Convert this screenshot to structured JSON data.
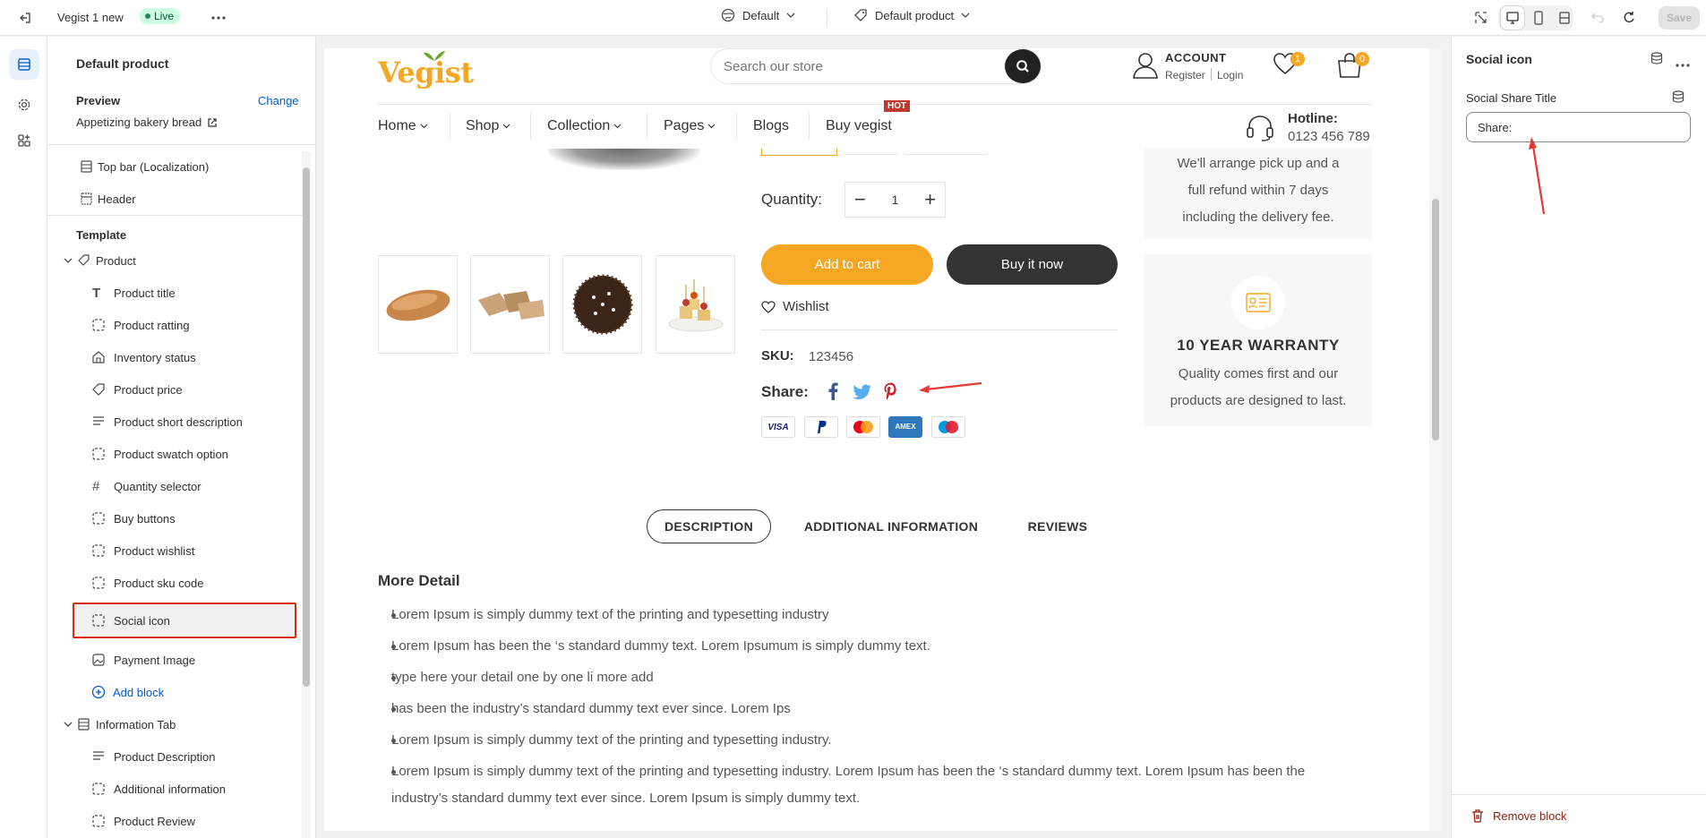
{
  "topbar": {
    "title": "Vegist 1 new",
    "status": "Live",
    "theme_select": "Default",
    "template_select": "Default product",
    "save_label": "Save"
  },
  "sidebar": {
    "heading": "Default product",
    "preview_label": "Preview",
    "preview_change": "Change",
    "preview_value": "Appetizing bakery bread",
    "top_items": [
      "Top bar (Localization)",
      "Header"
    ],
    "template_label": "Template",
    "product_section": "Product",
    "product_blocks": [
      "Product title",
      "Product ratting",
      "Inventory status",
      "Product price",
      "Product short description",
      "Product swatch option",
      "Quantity selector",
      "Buy buttons",
      "Product wishlist",
      "Product sku code",
      "Social icon",
      "Payment Image"
    ],
    "add_block": "Add block",
    "info_section": "Information Tab",
    "info_blocks": [
      "Product Description",
      "Additional information",
      "Product Review"
    ]
  },
  "store": {
    "logo": "Vegist",
    "search_placeholder": "Search our store",
    "account_title": "ACCOUNT",
    "register": "Register",
    "login": "Login",
    "wishlist_count": "1",
    "cart_count": "0",
    "nav": [
      "Home",
      "Shop",
      "Collection",
      "Pages",
      "Blogs",
      "Buy vegist"
    ],
    "hot_badge": "HOT",
    "hotline_label": "Hotline:",
    "hotline_number": "0123 456 789",
    "quantity_label": "Quantity:",
    "quantity_value": "1",
    "add_to_cart": "Add to cart",
    "buy_now": "Buy it now",
    "wishlist": "Wishlist",
    "sku_label": "SKU:",
    "sku_value": "123456",
    "share_label": "Share:",
    "payments": [
      "VISA",
      "PayPal",
      "Mastercard",
      "AMEX",
      "Maestro"
    ],
    "refund_text": [
      "We'll arrange pick up and a",
      "full refund within 7 days",
      "including the delivery fee."
    ],
    "warranty_title": "10 YEAR WARRANTY",
    "warranty_text": [
      "Quality comes first and our",
      "products are designed to last."
    ],
    "tabs": [
      "DESCRIPTION",
      "ADDITIONAL INFORMATION",
      "REVIEWS"
    ],
    "detail_heading": "More Detail",
    "detail_items": [
      "Lorem Ipsum is simply dummy text of the printing and typesetting industry",
      "Lorem Ipsum has been the ‘s standard dummy text. Lorem Ipsumum is simply dummy text.",
      "type here your detail one by one li more add",
      "has been the industry’s standard dummy text ever since. Lorem Ips",
      "Lorem Ipsum is simply dummy text of the printing and typesetting industry.",
      "Lorem Ipsum is simply dummy text of the printing and typesetting industry. Lorem Ipsum has been the ‘s standard dummy text. Lorem Ipsum has been the industry’s standard dummy text ever since. Lorem Ipsum is simply dummy text."
    ]
  },
  "rpanel": {
    "title": "Social icon",
    "field_label": "Social Share Title",
    "field_value": "Share:",
    "remove": "Remove block"
  },
  "colors": {
    "brand_orange": "#f5a623",
    "brand_green": "#6aa629",
    "highlight_red": "#d72c0d",
    "accent_blue": "#005bd3"
  }
}
